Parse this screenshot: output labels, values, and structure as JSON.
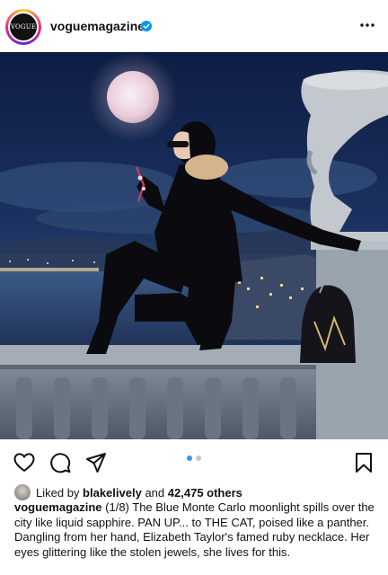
{
  "post": {
    "username": "voguemagazine",
    "avatar_text": "VOGUE",
    "verified_icon": "verified-badge-icon",
    "more_icon": "more-options-icon"
  },
  "image": {
    "description_icon": "photo"
  },
  "actions": {
    "like_icon": "heart-icon",
    "comment_icon": "comment-icon",
    "share_icon": "send-icon",
    "save_icon": "bookmark-icon",
    "carousel_current": 1,
    "carousel_total": 2
  },
  "likes": {
    "prefix": "Liked by",
    "user": "blakelively",
    "middle": "and",
    "others": "42,475 others"
  },
  "caption": {
    "username": "voguemagazine",
    "text": "(1/8) The Blue Monte Carlo moonlight spills over the city like liquid sapphire. PAN UP... to THE CAT, poised like a panther. Dangling from her hand, Elizabeth Taylor's famed ruby necklace. Her eyes glittering like the stolen jewels, she lives for this."
  },
  "colors": {
    "accent_blue": "#3897f0",
    "verified_blue": "#0095f6"
  }
}
